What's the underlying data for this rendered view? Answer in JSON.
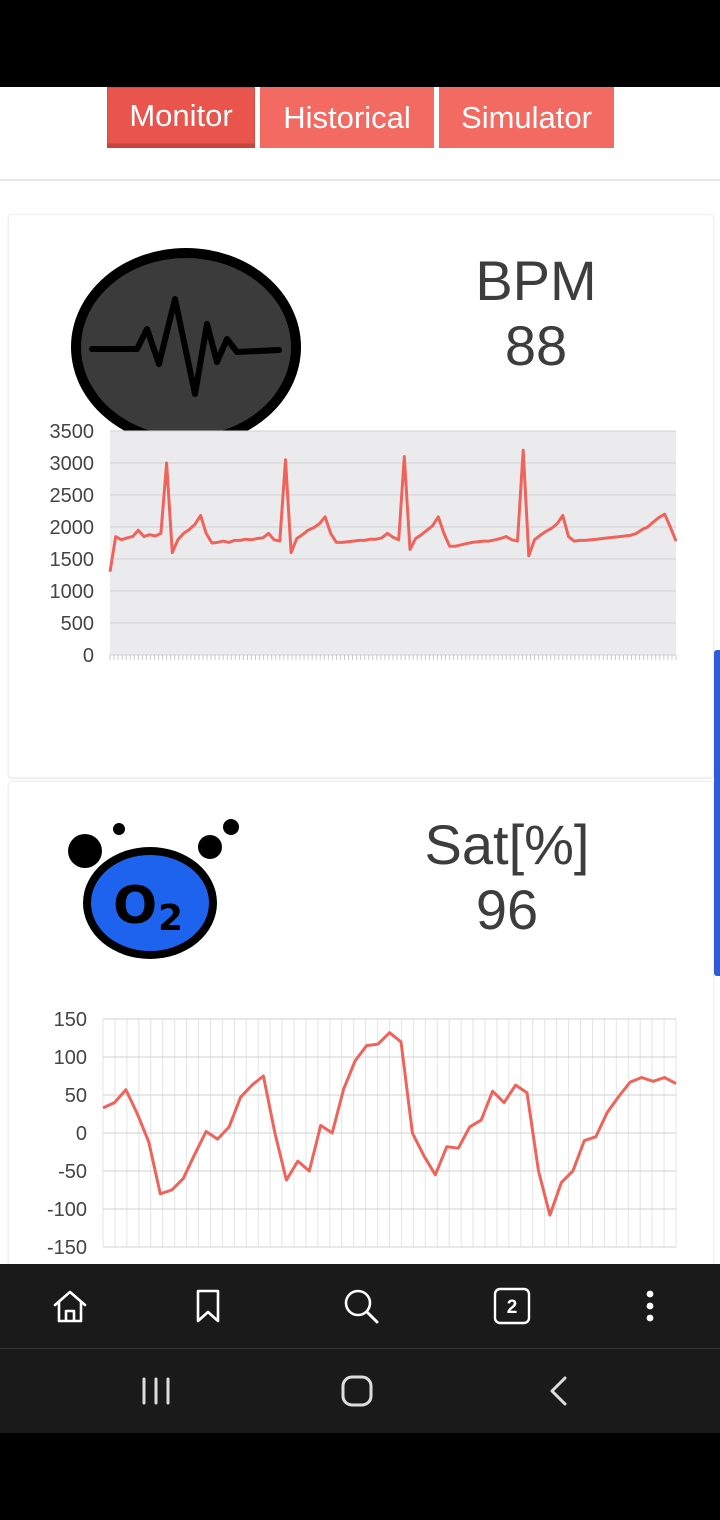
{
  "tabs": [
    {
      "label": "Monitor",
      "active": true
    },
    {
      "label": "Historical",
      "active": false
    },
    {
      "label": "Simulator",
      "active": false
    }
  ],
  "bpm_card": {
    "icon": "heartbeat-icon",
    "label": "BPM",
    "value": "88",
    "chart_data": {
      "type": "line",
      "y_ticks": [
        "3500",
        "3000",
        "2500",
        "2000",
        "1500",
        "1000",
        "500",
        "0"
      ],
      "ylim": [
        0,
        3500
      ],
      "grid": true,
      "background": "#ebebee",
      "line_color": "#f0635a",
      "x": [
        0,
        1,
        2,
        3,
        4,
        5,
        6,
        7,
        8,
        9,
        10,
        11,
        12,
        13,
        14,
        15,
        16,
        17,
        18,
        19,
        20,
        21,
        22,
        23,
        24,
        25,
        26,
        27,
        28,
        29,
        30,
        31,
        32,
        33,
        34,
        35,
        36,
        37,
        38,
        39,
        40,
        41,
        42,
        43,
        44,
        45,
        46,
        47,
        48,
        49,
        50,
        51,
        52,
        53,
        54,
        55,
        56,
        57,
        58,
        59,
        60,
        61,
        62,
        63,
        64,
        65,
        66,
        67,
        68,
        69,
        70,
        71,
        72,
        73,
        74,
        75,
        76,
        77,
        78,
        79,
        80,
        81,
        82,
        83,
        84,
        85,
        86,
        87,
        88,
        89,
        90,
        91,
        92,
        93,
        94,
        95,
        96,
        97,
        98,
        99,
        100
      ],
      "values": [
        1300,
        1850,
        1800,
        1830,
        1850,
        1950,
        1850,
        1880,
        1860,
        1900,
        3000,
        1600,
        1800,
        1900,
        1960,
        2040,
        2180,
        1900,
        1750,
        1760,
        1780,
        1760,
        1790,
        1790,
        1810,
        1800,
        1820,
        1830,
        1900,
        1800,
        1780,
        3050,
        1600,
        1820,
        1880,
        1950,
        1990,
        2050,
        2160,
        1900,
        1760,
        1760,
        1770,
        1780,
        1790,
        1790,
        1810,
        1810,
        1830,
        1900,
        1840,
        1800,
        3100,
        1650,
        1820,
        1880,
        1950,
        2020,
        2160,
        1900,
        1700,
        1700,
        1720,
        1740,
        1760,
        1770,
        1780,
        1780,
        1800,
        1820,
        1850,
        1800,
        1780,
        3200,
        1550,
        1800,
        1870,
        1930,
        1980,
        2050,
        2180,
        1850,
        1780,
        1790,
        1790,
        1800,
        1810,
        1820,
        1830,
        1840,
        1850,
        1860,
        1870,
        1900,
        1960,
        2000,
        2080,
        2150,
        2200,
        2000,
        1780
      ]
    }
  },
  "sat_card": {
    "icon": "oxygen-o2-icon",
    "label": "Sat[%]",
    "value": "96",
    "chart_data": {
      "type": "line",
      "y_ticks": [
        "150",
        "100",
        "50",
        "0",
        "-50",
        "-100",
        "-150"
      ],
      "ylim": [
        -150,
        150
      ],
      "grid": true,
      "background": "#ffffff",
      "line_color": "#f0635a",
      "x": [
        0,
        1,
        2,
        3,
        4,
        5,
        6,
        7,
        8,
        9,
        10,
        11,
        12,
        13,
        14,
        15,
        16,
        17,
        18,
        19,
        20,
        21,
        22,
        23,
        24,
        25,
        26,
        27,
        28,
        29,
        30,
        31,
        32,
        33,
        34,
        35,
        36,
        37,
        38,
        39,
        40,
        41,
        42,
        43,
        44,
        45,
        46,
        47,
        48,
        49,
        50
      ],
      "values": [
        33,
        40,
        57,
        25,
        -12,
        -80,
        -75,
        -60,
        -28,
        2,
        -8,
        8,
        47,
        63,
        75,
        0,
        -62,
        -37,
        -50,
        10,
        0,
        58,
        95,
        115,
        117,
        132,
        120,
        0,
        -30,
        -55,
        -18,
        -20,
        8,
        17,
        55,
        40,
        63,
        53,
        -50,
        -108,
        -65,
        -50,
        -10,
        -5,
        27,
        48,
        67,
        73,
        68,
        73,
        65
      ]
    }
  },
  "browser_bar": {
    "home_icon": "home-icon",
    "bookmark_icon": "bookmark-icon",
    "search_icon": "search-icon",
    "tabs_count": "2",
    "menu_icon": "more-vertical-icon"
  },
  "system_nav": {
    "recent_icon": "recent-apps-icon",
    "home_icon": "home-circle-icon",
    "back_icon": "back-chevron-icon"
  }
}
